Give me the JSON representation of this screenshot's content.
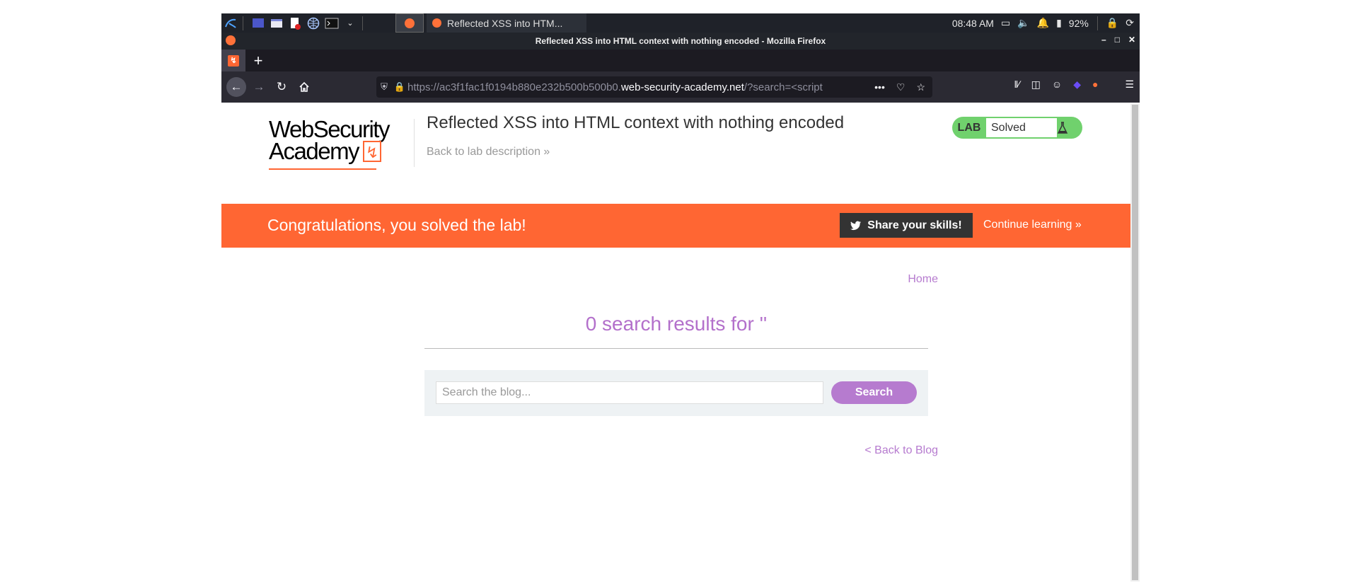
{
  "taskbar": {
    "active_task_label": "Reflected XSS into HTM...",
    "clock": "08:48 AM",
    "battery": "92%"
  },
  "window": {
    "title": "Reflected XSS into HTML context with nothing encoded - Mozilla Firefox"
  },
  "tabs": {
    "new_tab_symbol": "+"
  },
  "navbar": {
    "url_prefix": "https://ac3f1fac1f0194b880e232b500b500b0.",
    "url_domain": "web-security-academy.net",
    "url_suffix": "/?search=<script",
    "overflow_symbol": "•••"
  },
  "page": {
    "logo_line1": "WebSecurity",
    "logo_line2": "Academy",
    "lab_title": "Reflected XSS into HTML context with nothing encoded",
    "back_to_lab": "Back to lab description »",
    "lab_badge": {
      "tag": "LAB",
      "status": "Solved"
    },
    "banner": {
      "message": "Congratulations, you solved the lab!",
      "share": "Share your skills!",
      "continue": "Continue learning »"
    },
    "home_link": "Home",
    "results_heading": "0 search results for ''",
    "search": {
      "placeholder": "Search the blog...",
      "button": "Search"
    },
    "back_to_blog": "< Back to Blog"
  },
  "colors": {
    "accent_orange": "#ff6633",
    "link_purple": "#b67bcf",
    "lab_green": "#70d16d"
  }
}
